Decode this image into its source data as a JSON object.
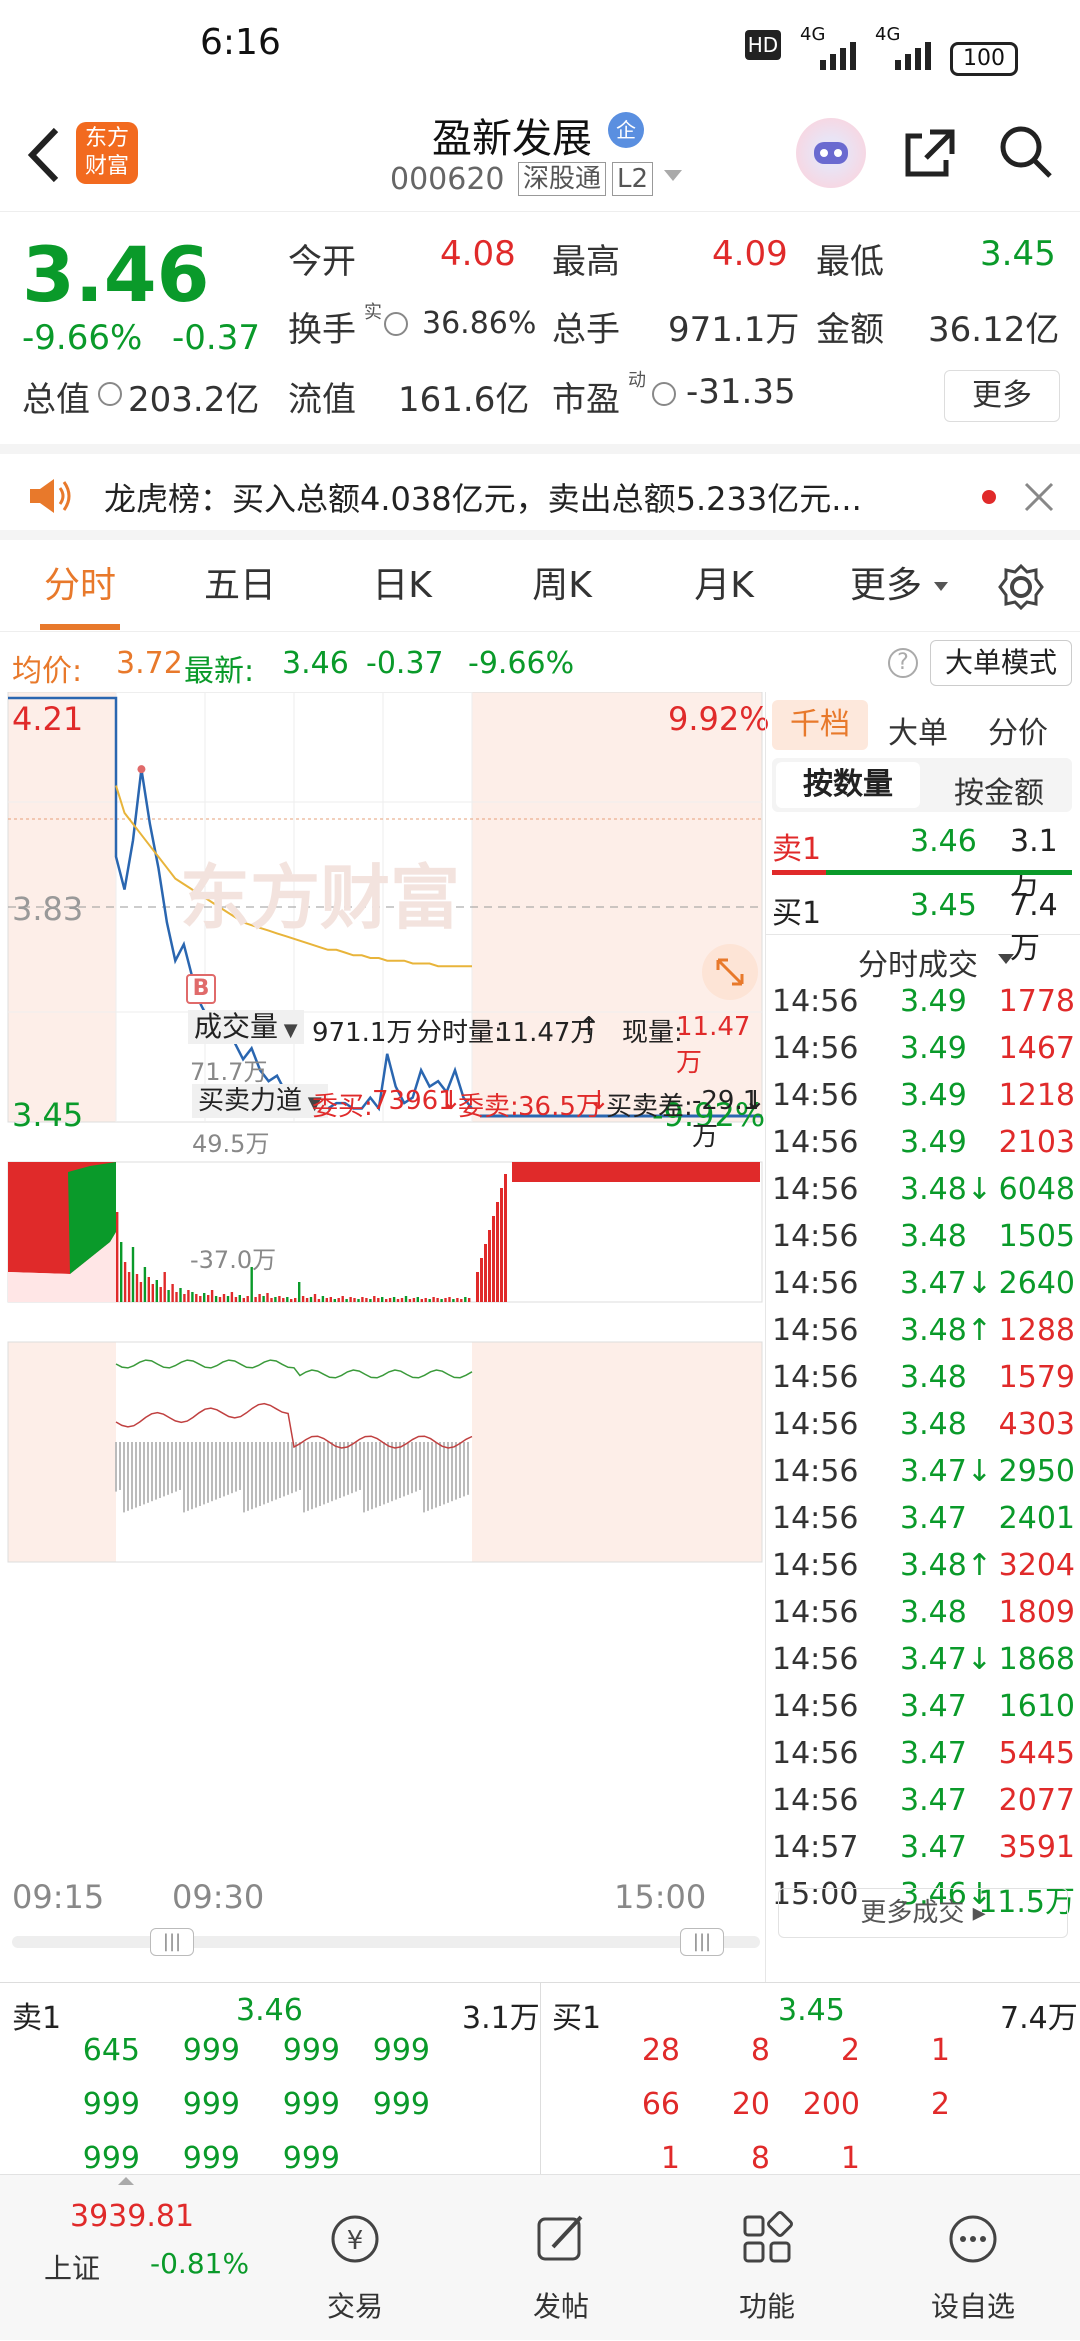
{
  "status_bar": {
    "time": "6:16",
    "hd": "HD",
    "net1": "4G",
    "net2": "4G",
    "battery": "100"
  },
  "header": {
    "back": "back",
    "logo_line1": "东方",
    "logo_line2": "财富",
    "title": "盈新发展",
    "title_badge": "企",
    "code": "000620",
    "connect": "深股通",
    "level": "L2"
  },
  "quote": {
    "price": "3.46",
    "pct": "-9.66%",
    "chg": "-0.37",
    "open_label": "今开",
    "open": "4.08",
    "high_label": "最高",
    "high": "4.09",
    "low_label": "最低",
    "low": "3.45",
    "turnover_label": "换手",
    "turnover_sup": "实",
    "turnover": "36.86%",
    "volume_label": "总手",
    "volume": "971.1万",
    "amount_label": "金额",
    "amount": "36.12亿",
    "mcap_label": "总值",
    "mcap": "203.2亿",
    "float_label": "流值",
    "float": "161.6亿",
    "pe_label": "市盈",
    "pe_sup": "动",
    "pe": "-31.35",
    "more": "更多"
  },
  "notice": {
    "text": "龙虎榜：买入总额4.038亿元，卖出总额5.233亿元..."
  },
  "tabs": [
    "分时",
    "五日",
    "日K",
    "周K",
    "月K",
    "更多"
  ],
  "chart_info": {
    "avg_label": "均价:",
    "avg": "3.72",
    "latest_label": "最新:",
    "latest": "3.46",
    "latest_chg": "-0.37",
    "latest_pct": "-9.66%",
    "big_mode": "大单模式"
  },
  "chart_data": {
    "type": "line",
    "price_labels": {
      "top": "4.21",
      "mid": "3.83",
      "bottom": "3.45"
    },
    "pct_labels": {
      "top": "9.92%",
      "bottom": "-9.92%"
    },
    "ylim": [
      3.45,
      4.21
    ],
    "x_ticks": [
      "09:15",
      "09:30",
      "15:00"
    ],
    "series": [
      {
        "name": "price",
        "values": [
          4.21,
          4.21,
          4.21,
          4.21,
          3.92,
          3.86,
          3.95,
          4.08,
          3.98,
          3.9,
          3.8,
          3.73,
          3.76,
          3.7,
          3.65,
          3.62,
          3.6,
          3.63,
          3.58,
          3.55,
          3.57,
          3.53,
          3.51,
          3.52,
          3.49,
          3.5,
          3.48,
          3.47,
          3.48,
          3.46,
          3.47,
          3.47,
          3.46,
          3.46,
          3.48,
          3.46,
          3.56,
          3.5,
          3.47,
          3.48,
          3.53,
          3.5,
          3.51,
          3.49,
          3.53,
          3.48,
          3.46
        ]
      },
      {
        "name": "avg",
        "values": [
          null,
          null,
          null,
          null,
          4.05,
          4.0,
          3.98,
          3.96,
          3.94,
          3.92,
          3.9,
          3.88,
          3.87,
          3.86,
          3.85,
          3.84,
          3.83,
          3.82,
          3.81,
          3.8,
          3.795,
          3.79,
          3.785,
          3.78,
          3.775,
          3.77,
          3.765,
          3.76,
          3.755,
          3.75,
          3.75,
          3.745,
          3.74,
          3.74,
          3.735,
          3.735,
          3.73,
          3.73,
          3.73,
          3.725,
          3.725,
          3.725,
          3.72,
          3.72,
          3.72,
          3.72,
          3.72
        ]
      }
    ],
    "volume_label": "成交量",
    "volume_total": "971.1万",
    "time_vol_label": "分时量:",
    "time_vol": "11.47万",
    "cur_vol_label": "现量:",
    "cur_vol": "11.47万",
    "volume_max_label": "71.7万",
    "force_label": "买卖力道",
    "bid_label": "委买:",
    "bid": "73961",
    "ask_label": "委卖:",
    "ask": "36.5万",
    "diff_label": "买卖差:",
    "diff": "-29.1万",
    "force_top": "49.5万",
    "force_bottom": "-37.0万"
  },
  "side": {
    "tabs": [
      "千档",
      "大单",
      "分价"
    ],
    "subtabs": [
      "按数量",
      "按金额"
    ],
    "sell1_label": "卖1",
    "sell1_price": "3.46",
    "sell1_vol": "3.1万",
    "buy1_label": "买1",
    "buy1_price": "3.45",
    "buy1_vol": "7.4万",
    "trades_title": "分时成交",
    "trades": [
      {
        "time": "14:56",
        "price": "3.49",
        "vol": "1778",
        "c": "red"
      },
      {
        "time": "14:56",
        "price": "3.49",
        "vol": "1467",
        "c": "red"
      },
      {
        "time": "14:56",
        "price": "3.49",
        "vol": "1218",
        "c": "red"
      },
      {
        "time": "14:56",
        "price": "3.49",
        "vol": "2103",
        "c": "red"
      },
      {
        "time": "14:56",
        "price": "3.48↓",
        "vol": "6048",
        "c": "green"
      },
      {
        "time": "14:56",
        "price": "3.48",
        "vol": "1505",
        "c": "green"
      },
      {
        "time": "14:56",
        "price": "3.47↓",
        "vol": "2640",
        "c": "green"
      },
      {
        "time": "14:56",
        "price": "3.48↑",
        "vol": "1288",
        "c": "red"
      },
      {
        "time": "14:56",
        "price": "3.48",
        "vol": "1579",
        "c": "red"
      },
      {
        "time": "14:56",
        "price": "3.48",
        "vol": "4303",
        "c": "red"
      },
      {
        "time": "14:56",
        "price": "3.47↓",
        "vol": "2950",
        "c": "green"
      },
      {
        "time": "14:56",
        "price": "3.47",
        "vol": "2401",
        "c": "green"
      },
      {
        "time": "14:56",
        "price": "3.48↑",
        "vol": "3204",
        "c": "red"
      },
      {
        "time": "14:56",
        "price": "3.48",
        "vol": "1809",
        "c": "red"
      },
      {
        "time": "14:56",
        "price": "3.47↓",
        "vol": "1868",
        "c": "green"
      },
      {
        "time": "14:56",
        "price": "3.47",
        "vol": "1610",
        "c": "green"
      },
      {
        "time": "14:56",
        "price": "3.47",
        "vol": "5445",
        "c": "red"
      },
      {
        "time": "14:56",
        "price": "3.47",
        "vol": "2077",
        "c": "red"
      },
      {
        "time": "14:57",
        "price": "3.47",
        "vol": "3591",
        "c": "red"
      },
      {
        "time": "15:00",
        "price": "3.46↓",
        "vol": "11.5万",
        "c": "green"
      }
    ],
    "more_trades": "更多成交"
  },
  "book": {
    "sell_label": "卖1",
    "sell_price": "3.46",
    "sell_vol": "3.1万",
    "buy_label": "买1",
    "buy_price": "3.45",
    "buy_vol": "7.4万",
    "sell_rows": [
      [
        "645",
        "999",
        "999",
        "999"
      ],
      [
        "999",
        "999",
        "999",
        "999"
      ],
      [
        "999",
        "999",
        "999",
        ""
      ]
    ],
    "buy_rows": [
      [
        "28",
        "8",
        "2",
        "1"
      ],
      [
        "66",
        "20",
        "200",
        "2"
      ],
      [
        "1",
        "8",
        "1",
        ""
      ]
    ]
  },
  "bottom_nav": {
    "index_value": "3939.81",
    "index_name": "上证",
    "index_pct": "-0.81%",
    "items": [
      "交易",
      "发帖",
      "功能",
      "设自选"
    ]
  },
  "colors": {
    "accent": "#e8792b",
    "up": "#e02a2a",
    "down": "#0a9a2a",
    "line": "#2a66b0",
    "avg": "#e8b43a"
  }
}
